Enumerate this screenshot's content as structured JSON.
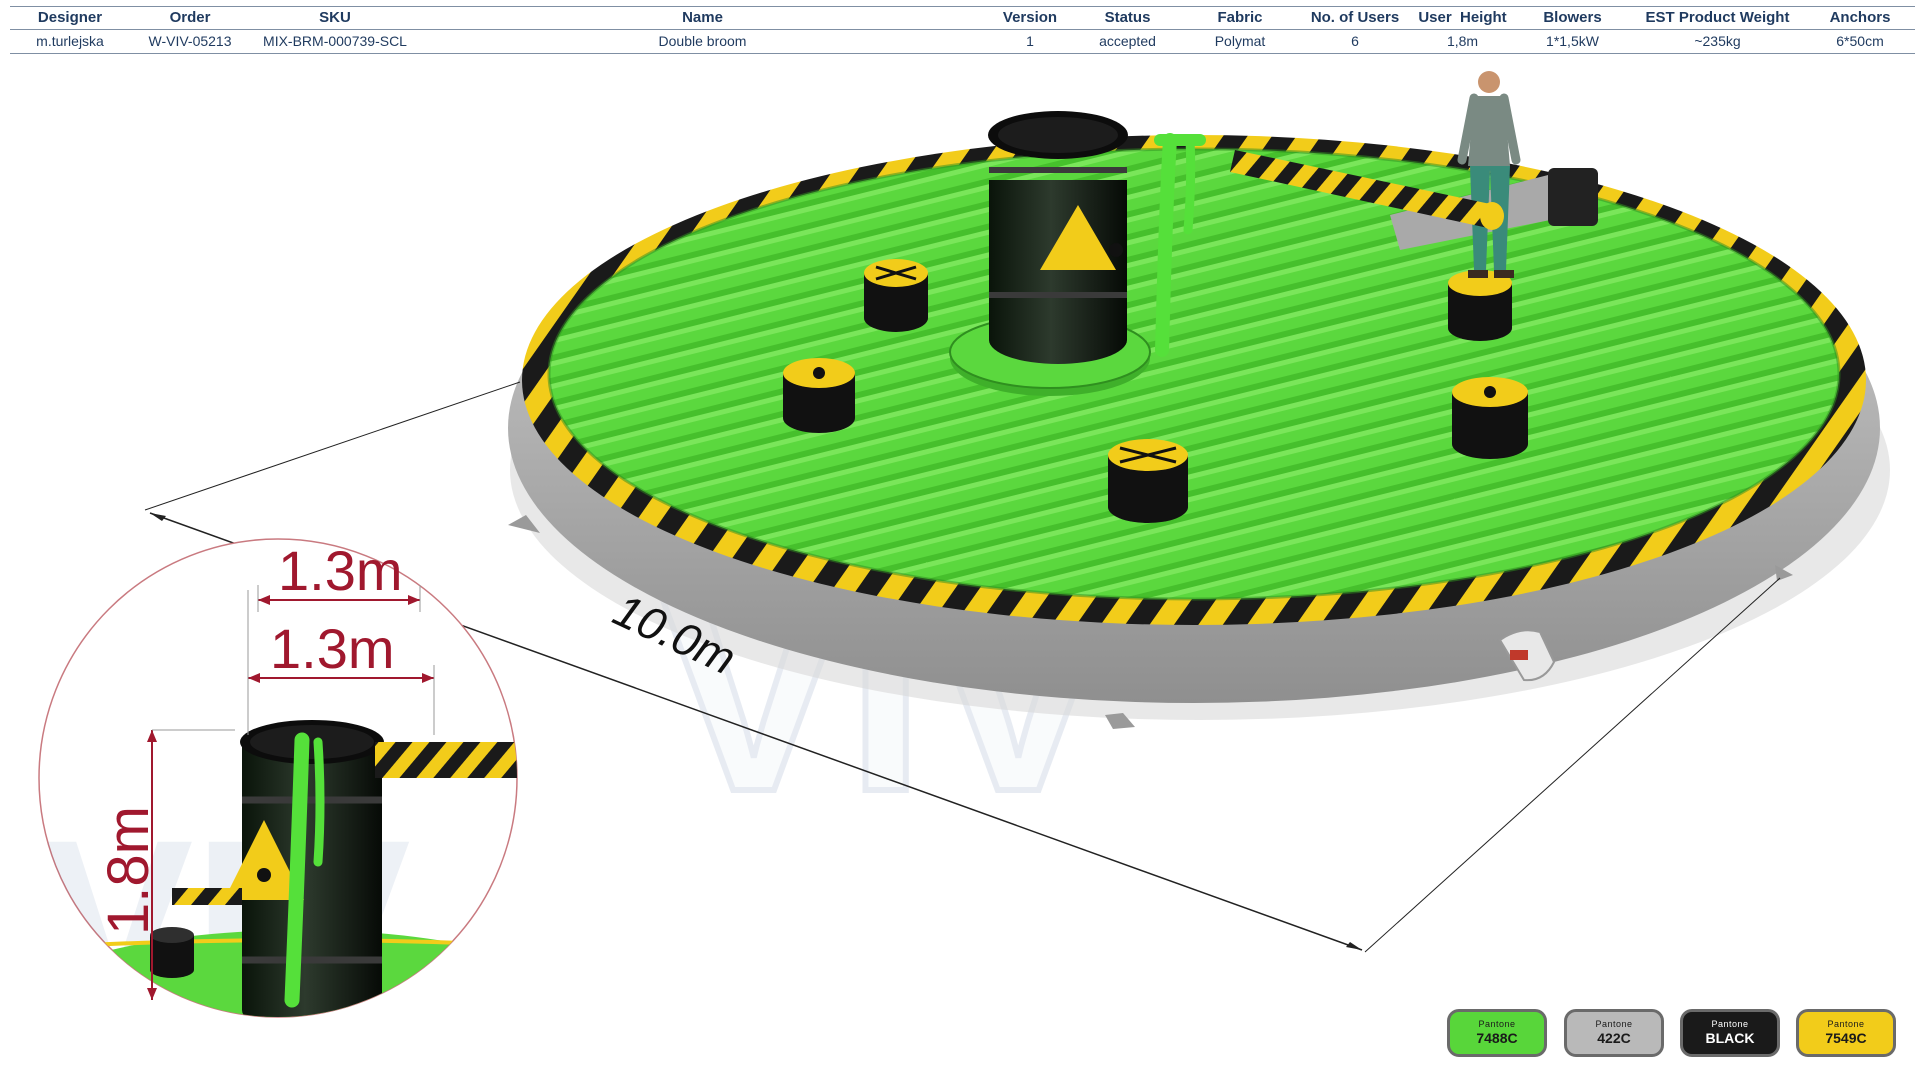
{
  "spec_table": {
    "headers": [
      "Designer",
      "Order",
      "SKU",
      "Name",
      "Version",
      "Status",
      "Fabric",
      "No. of Users",
      "User  Height",
      "Blowers",
      "EST Product Weight",
      "Anchors"
    ],
    "values": [
      "m.turlejska",
      "W-VIV-05213",
      "MIX-BRM-000739-SCL",
      "Double broom",
      "1",
      "accepted",
      "Polymat",
      "6",
      "1,8m",
      "1*1,5kW",
      "~235kg",
      "6*50cm"
    ]
  },
  "dimensions": {
    "diameter": "10.0m",
    "width_top": "1.3m",
    "width_lower": "1.3m",
    "height": "1.8m"
  },
  "watermark": "VIV",
  "colors": {
    "green": "#58d63a",
    "green_dark": "#3fb02a",
    "grey": "#b9b9b9",
    "black": "#1a1a1a",
    "yellow": "#f2cc1a",
    "dimension_red": "#a0182e",
    "header_text": "#1f3a5f"
  },
  "swatches": [
    {
      "label_small": "Pantone",
      "label_big": "7488C",
      "color": "#58d63a",
      "text_color": "#1a1a1a"
    },
    {
      "label_small": "Pantone",
      "label_big": "422C",
      "color": "#b9b9b9",
      "text_color": "#1a1a1a"
    },
    {
      "label_small": "Pantone",
      "label_big": "BLACK",
      "color": "#1a1a1a",
      "text_color": "#ffffff"
    },
    {
      "label_small": "Pantone",
      "label_big": "7549C",
      "color": "#f2cc1a",
      "text_color": "#1a1a1a"
    }
  ]
}
